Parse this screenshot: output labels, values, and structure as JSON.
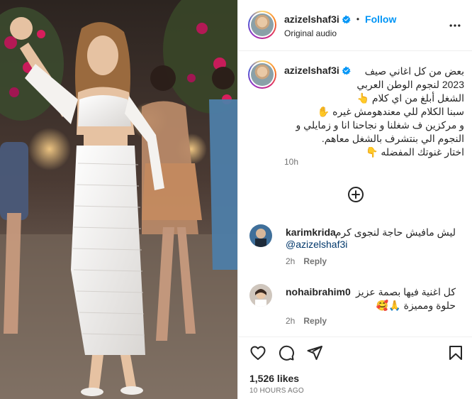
{
  "post": {
    "username": "azizelshaf3i",
    "follow_label": "Follow",
    "audio_label": "Original audio",
    "caption_lines": [
      "بعض من كل اغاني صيف",
      "2023 لنجوم الوطن العربي",
      "الشغل أبلغ من اي كلام 👆",
      "سبنا الكلام للي معندهومش غيره ✋",
      "و مركزين ف شغلنا و نجاحنا انا و زمايلي و",
      "النجوم الي بنتشرف بالشغل معاهم.",
      "اختار غنوتك المفضله 👇"
    ],
    "caption_time": "10h",
    "likes": "1,526 likes",
    "posted": "10 HOURS AGO"
  },
  "comments": [
    {
      "username": "karimkrida",
      "text": "ليش مافيش حاجة لنجوى كرم",
      "mention": "@azizelshaf3i",
      "time": "2h",
      "reply_label": "Reply"
    },
    {
      "username": "nohaibrahim0",
      "text": "كل اغنية فيها بصمة عزيز",
      "text2": "حلوة ومميزة 🙏🥰",
      "time": "2h",
      "reply_label": "Reply"
    }
  ],
  "icons": {
    "verified": "verified-badge-icon",
    "more": "more-options-icon",
    "load_more": "plus-circle-icon",
    "like": "heart-icon",
    "comment": "comment-bubble-icon",
    "share": "paper-plane-icon",
    "save": "bookmark-icon"
  },
  "colors": {
    "accent": "#0095f6",
    "text": "#262626",
    "muted": "#737373",
    "mention": "#00376b",
    "verified": "#0095f6"
  }
}
